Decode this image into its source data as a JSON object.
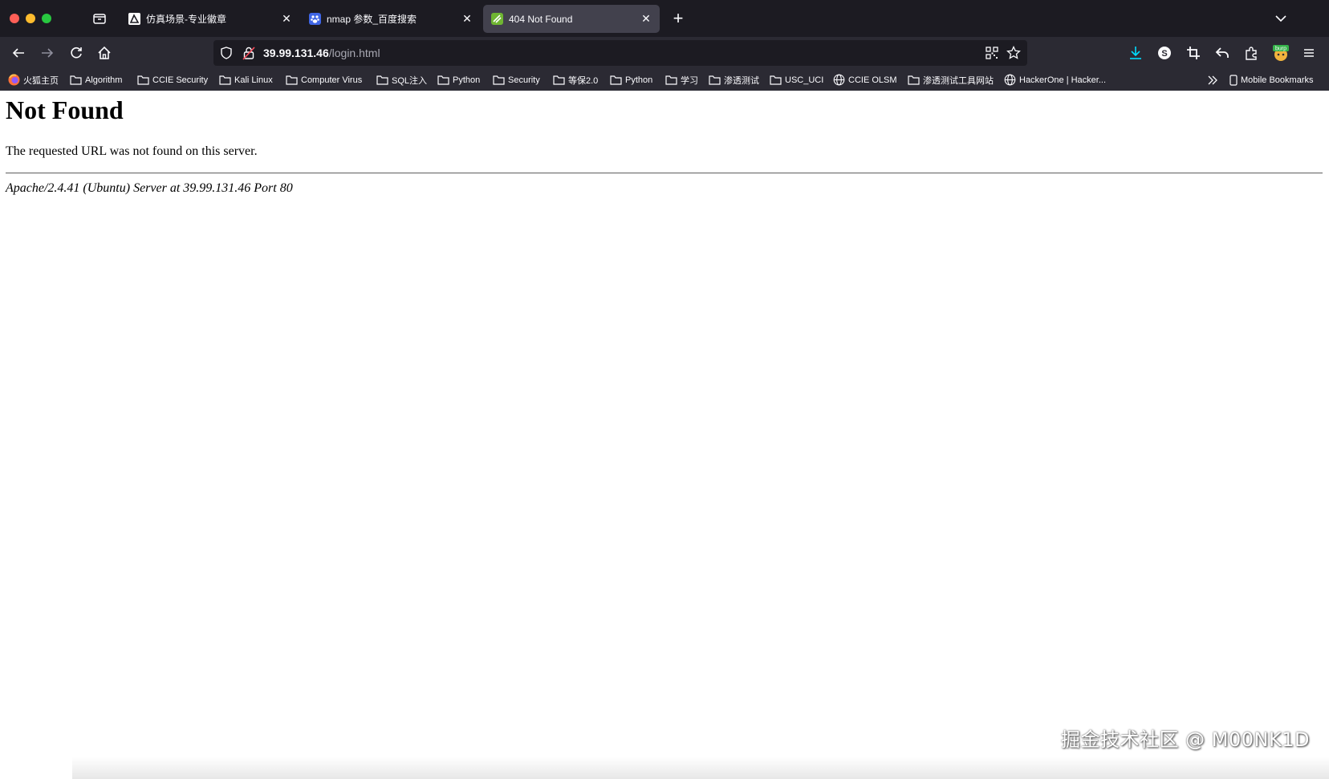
{
  "browser": {
    "tabs": [
      {
        "title": "仿真场景-专业徽章",
        "active": false,
        "favicon_color": "#ffffff"
      },
      {
        "title": "nmap 参数_百度搜索",
        "active": false,
        "favicon_color": "#3f66e6"
      },
      {
        "title": "404 Not Found",
        "active": true,
        "favicon_color": "#6fb632"
      }
    ],
    "url": {
      "host": "39.99.131.46",
      "path": "/login.html"
    },
    "bookmarks": [
      {
        "label": "火狐主页",
        "icon": "firefox-icon"
      },
      {
        "label": "Algorithm",
        "icon": "folder-icon"
      },
      {
        "label": "CCIE Security",
        "icon": "folder-icon"
      },
      {
        "label": "Kali Linux",
        "icon": "folder-icon"
      },
      {
        "label": "Computer Virus",
        "icon": "folder-icon"
      },
      {
        "label": "SQL注入",
        "icon": "folder-icon"
      },
      {
        "label": "Python",
        "icon": "folder-icon"
      },
      {
        "label": "Security",
        "icon": "folder-icon"
      },
      {
        "label": "等保2.0",
        "icon": "folder-icon"
      },
      {
        "label": "Python",
        "icon": "folder-icon"
      },
      {
        "label": "学习",
        "icon": "folder-icon"
      },
      {
        "label": "渗透测试",
        "icon": "folder-icon"
      },
      {
        "label": "USC_UCI",
        "icon": "folder-icon"
      },
      {
        "label": "CCIE OLSM",
        "icon": "globe-icon"
      },
      {
        "label": "渗透测试工具网站",
        "icon": "folder-icon"
      },
      {
        "label": "HackerOne | Hacker...",
        "icon": "globe-icon"
      }
    ],
    "mobile_bookmarks": "Mobile Bookmarks",
    "extension_badge": "burp"
  },
  "page": {
    "heading": "Not Found",
    "message": "The requested URL was not found on this server.",
    "server_signature": "Apache/2.4.41 (Ubuntu) Server at 39.99.131.46 Port 80"
  },
  "watermark": "掘金技术社区 @ M00NK1D"
}
